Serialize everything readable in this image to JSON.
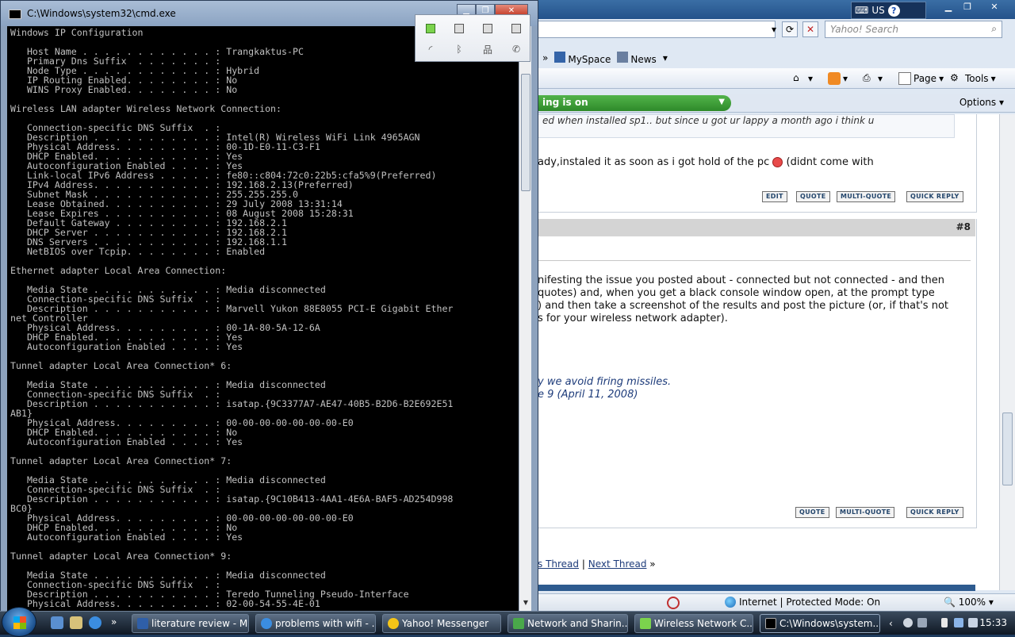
{
  "ie": {
    "lang": "US",
    "search_placeholder": "Yahoo! Search",
    "links": [
      "MySpace",
      "News"
    ],
    "cmdbar": {
      "page": "Page",
      "tools": "Tools"
    },
    "infobar": {
      "pill": "ing is on",
      "options": "Options"
    },
    "post1": {
      "quote_snippet": "ed when installed sp1.. but since u got ur lappy a month ago i think u",
      "text": "ady,instaled it as soon as i got hold of the pc",
      "text_tail": "(didnt come with"
    },
    "buttons": {
      "edit": "EDIT",
      "quote": "QUOTE",
      "multi_quote": "MULTI-QUOTE",
      "quick_reply": "QUICK REPLY"
    },
    "post2": {
      "number": "#8",
      "lines": [
        "nifesting the issue you posted about - connected but not connected - and then",
        "quotes) and, when you get a black console window open, at the prompt type",
        ") and then take a screenshot of the results and post the picture (or, if that's not",
        "s for your wireless network adapter)."
      ],
      "sig1": "y we avoid firing missiles.",
      "sig2": "e 9 (April 11, 2008)"
    },
    "nav": {
      "prev": "s Thread",
      "sep": "|",
      "next": "Next Thread",
      "arrow": "»"
    },
    "status": {
      "zone": "Internet | Protected Mode: On",
      "zoom": "100%"
    }
  },
  "cmd": {
    "title": "C:\\Windows\\system32\\cmd.exe",
    "console_text": "Windows IP Configuration\n\n   Host Name . . . . . . . . . . . . : Trangkaktus-PC\n   Primary Dns Suffix  . . . . . . . :\n   Node Type . . . . . . . . . . . . : Hybrid\n   IP Routing Enabled. . . . . . . . : No\n   WINS Proxy Enabled. . . . . . . . : No\n\nWireless LAN adapter Wireless Network Connection:\n\n   Connection-specific DNS Suffix  . :\n   Description . . . . . . . . . . . : Intel(R) Wireless WiFi Link 4965AGN\n   Physical Address. . . . . . . . . : 00-1D-E0-11-C3-F1\n   DHCP Enabled. . . . . . . . . . . : Yes\n   Autoconfiguration Enabled . . . . : Yes\n   Link-local IPv6 Address . . . . . : fe80::c804:72c0:22b5:cfa5%9(Preferred)\n   IPv4 Address. . . . . . . . . . . : 192.168.2.13(Preferred)\n   Subnet Mask . . . . . . . . . . . : 255.255.255.0\n   Lease Obtained. . . . . . . . . . : 29 July 2008 13:31:14\n   Lease Expires . . . . . . . . . . : 08 August 2008 15:28:31\n   Default Gateway . . . . . . . . . : 192.168.2.1\n   DHCP Server . . . . . . . . . . . : 192.168.2.1\n   DNS Servers . . . . . . . . . . . : 192.168.1.1\n   NetBIOS over Tcpip. . . . . . . . : Enabled\n\nEthernet adapter Local Area Connection:\n\n   Media State . . . . . . . . . . . : Media disconnected\n   Connection-specific DNS Suffix  . :\n   Description . . . . . . . . . . . : Marvell Yukon 88E8055 PCI-E Gigabit Ether\nnet Controller\n   Physical Address. . . . . . . . . : 00-1A-80-5A-12-6A\n   DHCP Enabled. . . . . . . . . . . : Yes\n   Autoconfiguration Enabled . . . . : Yes\n\nTunnel adapter Local Area Connection* 6:\n\n   Media State . . . . . . . . . . . : Media disconnected\n   Connection-specific DNS Suffix  . :\n   Description . . . . . . . . . . . : isatap.{9C3377A7-AE47-40B5-B2D6-B2E692E51\nAB1}\n   Physical Address. . . . . . . . . : 00-00-00-00-00-00-00-E0\n   DHCP Enabled. . . . . . . . . . . : No\n   Autoconfiguration Enabled . . . . : Yes\n\nTunnel adapter Local Area Connection* 7:\n\n   Media State . . . . . . . . . . . : Media disconnected\n   Connection-specific DNS Suffix  . :\n   Description . . . . . . . . . . . : isatap.{9C10B413-4AA1-4E6A-BAF5-AD254D998\nBC0}\n   Physical Address. . . . . . . . . : 00-00-00-00-00-00-00-E0\n   DHCP Enabled. . . . . . . . . . . : No\n   Autoconfiguration Enabled . . . . : Yes\n\nTunnel adapter Local Area Connection* 9:\n\n   Media State . . . . . . . . . . . : Media disconnected\n   Connection-specific DNS Suffix  . :\n   Description . . . . . . . . . . . : Teredo Tunneling Pseudo-Interface\n   Physical Address. . . . . . . . . : 02-00-54-55-4E-01"
  },
  "taskbar": {
    "items": [
      "literature review - M...",
      "problems with wifi - ...",
      "Yahoo! Messenger",
      "Network and Sharin...",
      "Wireless Network C...",
      "C:\\Windows\\system..."
    ],
    "clock": "15:33"
  }
}
